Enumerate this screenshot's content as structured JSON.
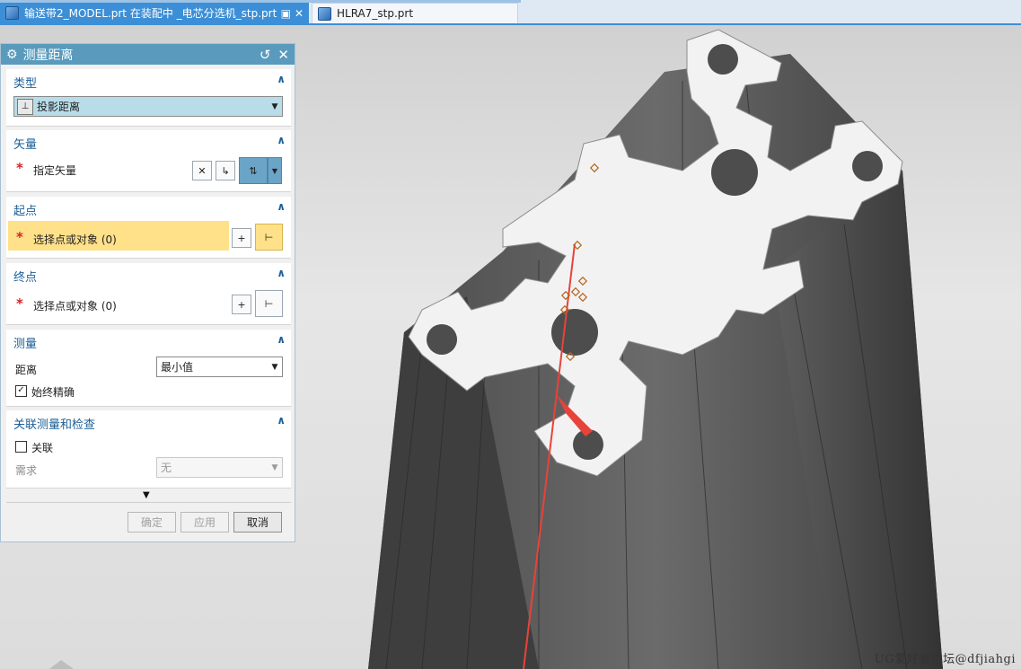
{
  "tabs": {
    "active_label": "输送带2_MODEL.prt 在装配中 _电芯分选机_stp.prt",
    "inactive_label": "HLRA7_stp.prt",
    "close_glyph": "✕"
  },
  "watermark": "UG爱好者论坛@dfjiahgi",
  "dialog": {
    "title": "测量距离",
    "type_section": {
      "header": "类型",
      "selected": "投影距离"
    },
    "vector_section": {
      "header": "矢量",
      "label": "指定矢量"
    },
    "start_section": {
      "header": "起点",
      "label": "选择点或对象 (0)"
    },
    "end_section": {
      "header": "终点",
      "label": "选择点或对象 (0)"
    },
    "measure_section": {
      "header": "测量",
      "distance_label": "距离",
      "distance_value": "最小值",
      "checkbox_label": "始终精确",
      "checkbox_checked": true
    },
    "assoc_section": {
      "header": "关联测量和检查",
      "checkbox_label": "关联",
      "checkbox_checked": false,
      "req_label": "需求",
      "req_value": "无"
    },
    "buttons": {
      "ok": "确定",
      "apply": "应用",
      "cancel": "取消"
    }
  },
  "colors": {
    "accent": "#3c8fd6",
    "dialog_title": "#5a9bbd",
    "section_header": "#1d5f96",
    "highlight": "#ffe18a",
    "required": "#d5232b",
    "measure_line": "#e8433a"
  },
  "icons": [
    "gear-icon",
    "reset-icon",
    "close-icon",
    "projected-distance-icon",
    "dropdown-arrow-icon",
    "inferred-vector-icon",
    "vector-dialog-icon",
    "vector-reverse-icon",
    "point-dialog-icon",
    "point-snap-icon",
    "expand-more-icon"
  ]
}
